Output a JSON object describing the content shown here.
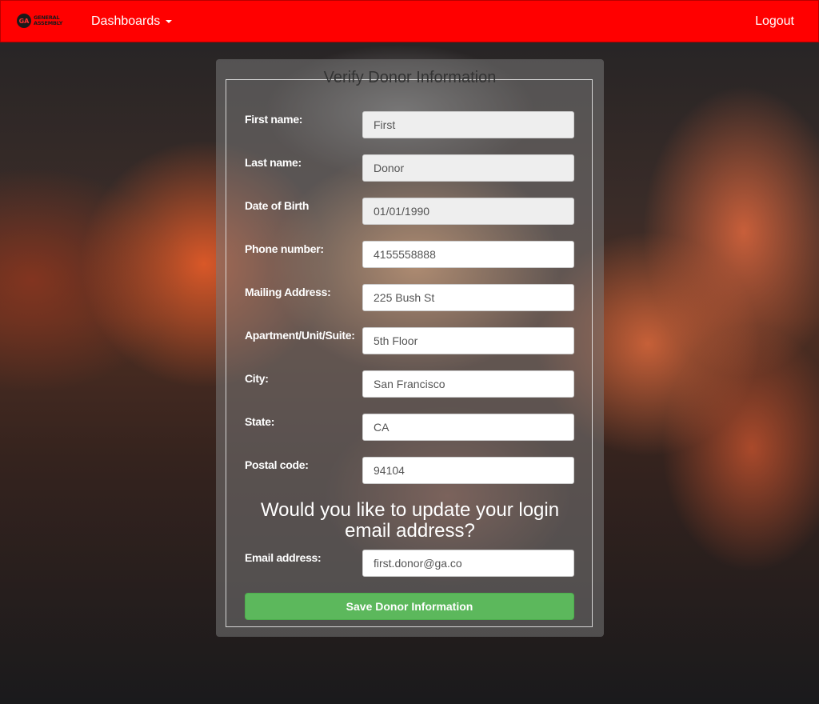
{
  "navbar": {
    "logo": {
      "badge": "GA",
      "line1": "GENERAL",
      "line2": "ASSEMBLY"
    },
    "dropdown_label": "Dashboards",
    "logout_label": "Logout"
  },
  "form": {
    "title": "Verify Donor Information",
    "fields": [
      {
        "label": "First name:",
        "value": "First",
        "readonly": true
      },
      {
        "label": "Last name:",
        "value": "Donor",
        "readonly": true
      },
      {
        "label": "Date of Birth",
        "value": "01/01/1990",
        "readonly": true
      },
      {
        "label": "Phone number:",
        "value": "4155558888",
        "readonly": false
      },
      {
        "label": "Mailing Address:",
        "value": "225 Bush St",
        "readonly": false
      },
      {
        "label": "Apartment/Unit/Suite:",
        "value": "5th Floor",
        "readonly": false
      },
      {
        "label": "City:",
        "value": "San Francisco",
        "readonly": false
      },
      {
        "label": "State:",
        "value": "CA",
        "readonly": false
      },
      {
        "label": "Postal code:",
        "value": "94104",
        "readonly": false
      }
    ],
    "email_question": "Would you like to update your login email address?",
    "email_field": {
      "label": "Email address:",
      "value": "first.donor@ga.co"
    },
    "save_label": "Save Donor Information"
  },
  "colors": {
    "navbar": "#ff0000",
    "save_button": "#5cb85c",
    "readonly_input": "#eeeeee"
  }
}
